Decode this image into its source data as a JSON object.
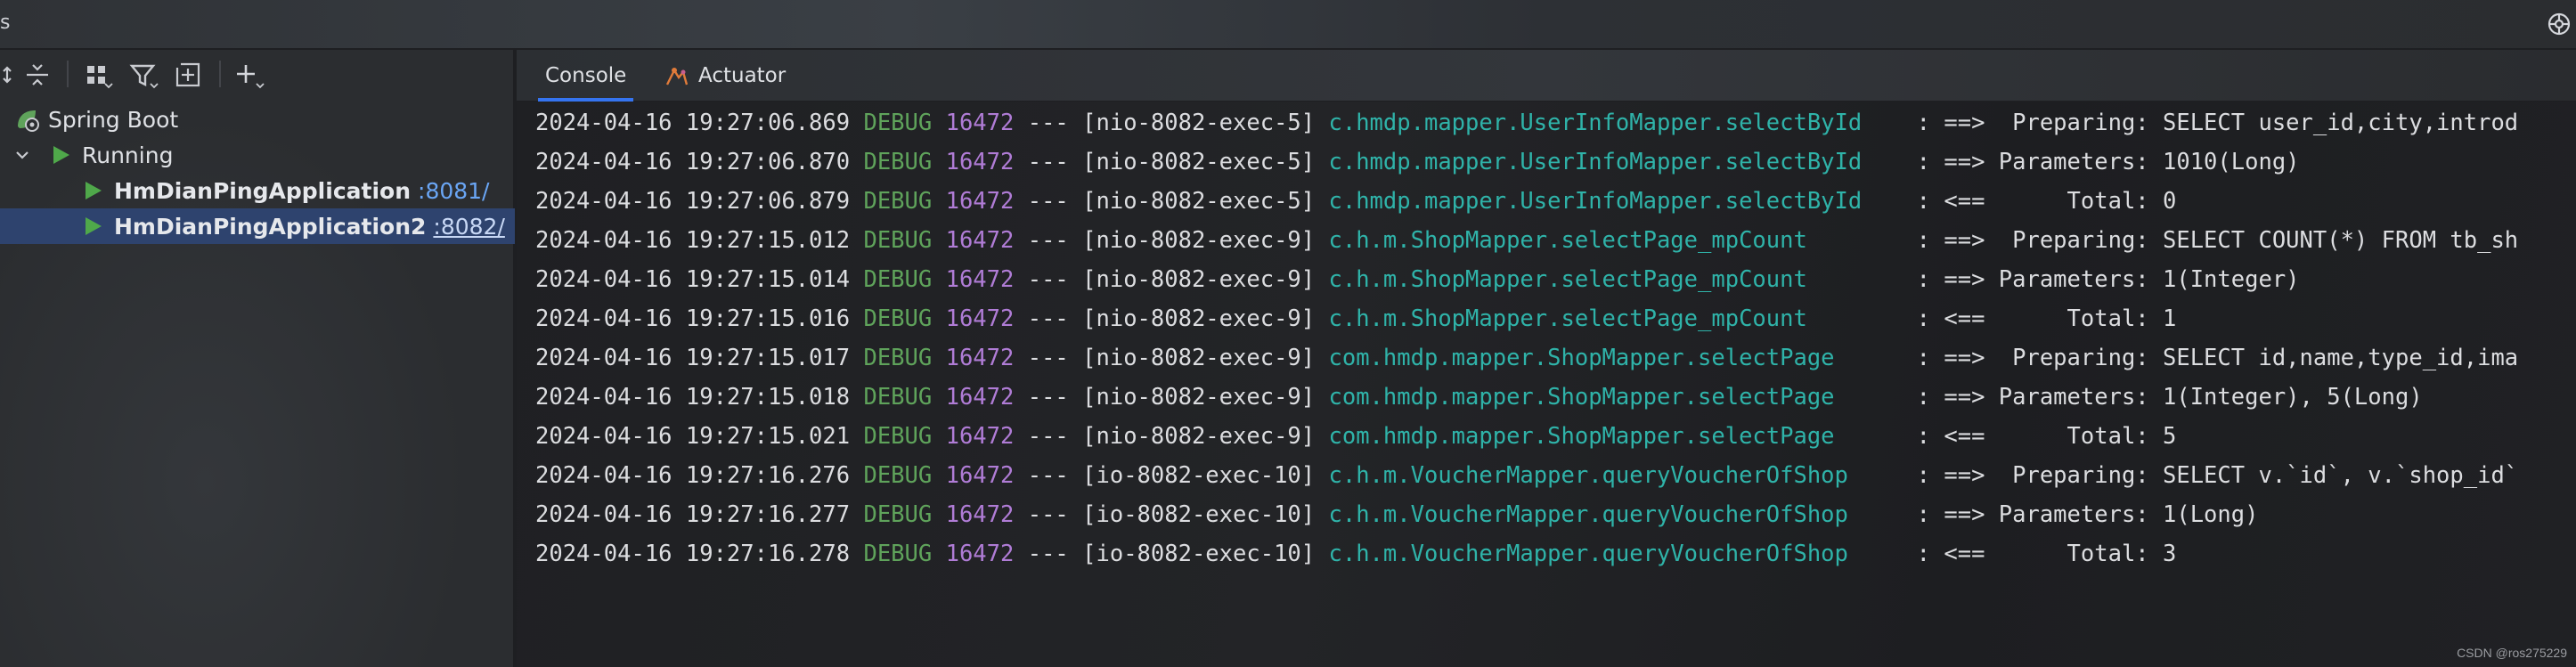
{
  "window": {
    "title": "s",
    "gear_icon": "settings-cog-icon"
  },
  "toolbar": {
    "buttons": [
      {
        "name": "expand-all-icon"
      },
      {
        "name": "collapse-all-icon"
      },
      {
        "name": "group-by-icon"
      },
      {
        "name": "filter-icon"
      },
      {
        "name": "new-tab-icon"
      },
      {
        "name": "add-icon"
      }
    ]
  },
  "tree": {
    "root_label": "Spring Boot",
    "group_label": "Running",
    "apps": [
      {
        "name": "HmDianPingApplication",
        "port": ":8081/",
        "selected": false
      },
      {
        "name": "HmDianPingApplication2",
        "port": ":8082/",
        "selected": true
      }
    ]
  },
  "tabs": [
    {
      "label": "Console",
      "active": true
    },
    {
      "label": "Actuator",
      "active": false
    }
  ],
  "colors": {
    "accent": "#3574f0",
    "debug": "#5fa35b",
    "pid": "#b07cd6",
    "logger": "#2fb3a9",
    "run_green": "#4fa84a"
  },
  "console": {
    "lines": [
      {
        "ts": "2024-04-16 19:27:06.869",
        "level": "DEBUG",
        "pid": "16472",
        "sep": "---",
        "thread": "[nio-8082-exec-5]",
        "logger": "c.hmdp.mapper.UserInfoMapper.selectById",
        "msg": ": ==>  Preparing: SELECT user_id,city,introd"
      },
      {
        "ts": "2024-04-16 19:27:06.870",
        "level": "DEBUG",
        "pid": "16472",
        "sep": "---",
        "thread": "[nio-8082-exec-5]",
        "logger": "c.hmdp.mapper.UserInfoMapper.selectById",
        "msg": ": ==> Parameters: 1010(Long)"
      },
      {
        "ts": "2024-04-16 19:27:06.879",
        "level": "DEBUG",
        "pid": "16472",
        "sep": "---",
        "thread": "[nio-8082-exec-5]",
        "logger": "c.hmdp.mapper.UserInfoMapper.selectById",
        "msg": ": <==      Total: 0"
      },
      {
        "ts": "2024-04-16 19:27:15.012",
        "level": "DEBUG",
        "pid": "16472",
        "sep": "---",
        "thread": "[nio-8082-exec-9]",
        "logger": "c.h.m.ShopMapper.selectPage_mpCount",
        "msg": ": ==>  Preparing: SELECT COUNT(*) FROM tb_sh"
      },
      {
        "ts": "2024-04-16 19:27:15.014",
        "level": "DEBUG",
        "pid": "16472",
        "sep": "---",
        "thread": "[nio-8082-exec-9]",
        "logger": "c.h.m.ShopMapper.selectPage_mpCount",
        "msg": ": ==> Parameters: 1(Integer)"
      },
      {
        "ts": "2024-04-16 19:27:15.016",
        "level": "DEBUG",
        "pid": "16472",
        "sep": "---",
        "thread": "[nio-8082-exec-9]",
        "logger": "c.h.m.ShopMapper.selectPage_mpCount",
        "msg": ": <==      Total: 1"
      },
      {
        "ts": "2024-04-16 19:27:15.017",
        "level": "DEBUG",
        "pid": "16472",
        "sep": "---",
        "thread": "[nio-8082-exec-9]",
        "logger": "com.hmdp.mapper.ShopMapper.selectPage",
        "msg": ": ==>  Preparing: SELECT id,name,type_id,ima"
      },
      {
        "ts": "2024-04-16 19:27:15.018",
        "level": "DEBUG",
        "pid": "16472",
        "sep": "---",
        "thread": "[nio-8082-exec-9]",
        "logger": "com.hmdp.mapper.ShopMapper.selectPage",
        "msg": ": ==> Parameters: 1(Integer), 5(Long)"
      },
      {
        "ts": "2024-04-16 19:27:15.021",
        "level": "DEBUG",
        "pid": "16472",
        "sep": "---",
        "thread": "[nio-8082-exec-9]",
        "logger": "com.hmdp.mapper.ShopMapper.selectPage",
        "msg": ": <==      Total: 5"
      },
      {
        "ts": "2024-04-16 19:27:16.276",
        "level": "DEBUG",
        "pid": "16472",
        "sep": "---",
        "thread": "[io-8082-exec-10]",
        "logger": "c.h.m.VoucherMapper.queryVoucherOfShop",
        "msg": ": ==>  Preparing: SELECT v.`id`, v.`shop_id`"
      },
      {
        "ts": "2024-04-16 19:27:16.277",
        "level": "DEBUG",
        "pid": "16472",
        "sep": "---",
        "thread": "[io-8082-exec-10]",
        "logger": "c.h.m.VoucherMapper.queryVoucherOfShop",
        "msg": ": ==> Parameters: 1(Long)"
      },
      {
        "ts": "2024-04-16 19:27:16.278",
        "level": "DEBUG",
        "pid": "16472",
        "sep": "---",
        "thread": "[io-8082-exec-10]",
        "logger": "c.h.m.VoucherMapper.queryVoucherOfShop",
        "msg": ": <==      Total: 3"
      }
    ]
  },
  "watermark": "CSDN @ros275229"
}
